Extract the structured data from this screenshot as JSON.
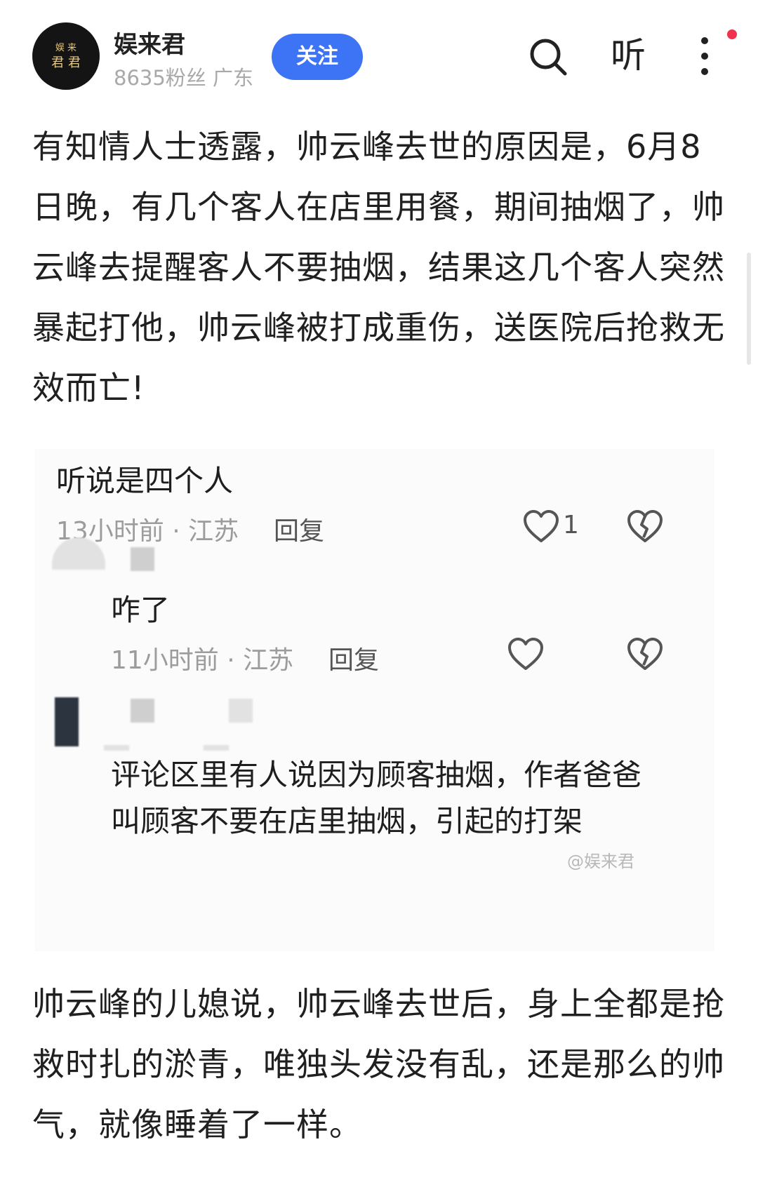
{
  "header": {
    "avatar_line1": "娱 来",
    "avatar_line2": "君 君",
    "author_name": "娱来君",
    "author_meta": "8635粉丝 广东",
    "follow_label": "关注",
    "listen_label": "听",
    "colors": {
      "follow": "#3d73f5",
      "notify_dot": "#f0324c"
    },
    "icons": [
      "search-icon",
      "more-vertical-icon"
    ]
  },
  "article": {
    "para1": "有知情人士透露，帅云峰去世的原因是，6月8日晚，有几个客人在店里用餐，期间抽烟了，帅云峰去提醒客人不要抽烟，结果这几个客人突然暴起打他，帅云峰被打成重伤，送医院后抢救无效而亡!",
    "para2": "帅云峰的儿媳说，帅云峰去世后，身上全都是抢救时扎的淤青，唯独头发没有乱，还是那么的帅气，就像睡着了一样。"
  },
  "screenshot_card": {
    "comment1": {
      "text": "听说是四个人",
      "meta": "13小时前 · 江苏",
      "reply": "回复",
      "likes": "1"
    },
    "comment2": {
      "text": "咋了",
      "meta": "11小时前 · 江苏",
      "reply": "回复"
    },
    "comment3": {
      "text": "评论区里有人说因为顾客抽烟，作者爸爸叫顾客不要在店里抽烟，引起的打架"
    },
    "watermark": "@娱来君"
  }
}
